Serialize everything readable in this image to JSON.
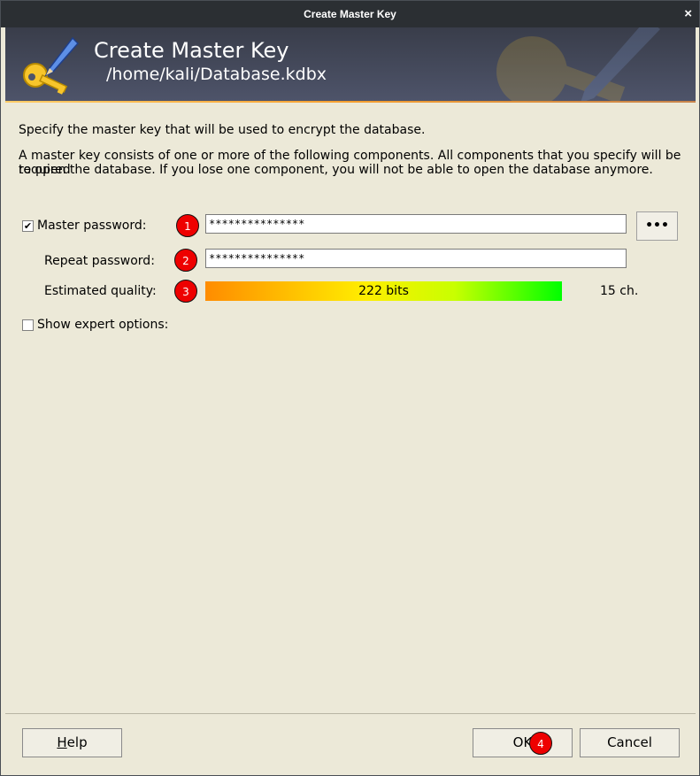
{
  "window": {
    "title": "Create Master Key",
    "close_glyph": "×"
  },
  "banner": {
    "title": "Create Master Key",
    "path": "/home/kali/Database.kdbx"
  },
  "intro": {
    "line1": "Specify the master key that will be used to encrypt the database.",
    "line2": "A master key consists of one or more of the following components. All components that you specify will be required",
    "line3": "to open the database. If you lose one component, you will not be able to open the database anymore."
  },
  "master_password": {
    "checked": true,
    "check_glyph": "✔",
    "label": "Master password:",
    "value": "***************",
    "badge": "1"
  },
  "repeat_password": {
    "label": "Repeat password:",
    "value": "***************",
    "badge": "2"
  },
  "quality": {
    "label": "Estimated quality:",
    "bits": "222 bits",
    "chars": "15 ch.",
    "badge": "3",
    "level": 1.0
  },
  "expert": {
    "checked": false,
    "label": "Show expert options:"
  },
  "buttons": {
    "dots": "•••",
    "help_h": "H",
    "help_rest": "elp",
    "ok": "OK",
    "ok_badge": "4",
    "cancel": "Cancel"
  }
}
